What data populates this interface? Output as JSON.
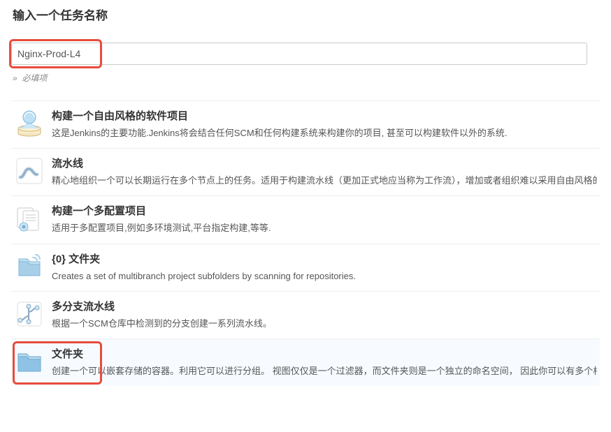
{
  "header": {
    "title": "输入一个任务名称"
  },
  "nameField": {
    "value": "Nginx-Prod-L4"
  },
  "requiredHint": "»  必填项",
  "items": [
    {
      "title": "构建一个自由风格的软件项目",
      "desc": "这是Jenkins的主要功能.Jenkins将会结合任何SCM和任何构建系统来构建你的项目, 甚至可以构建软件以外的系统."
    },
    {
      "title": "流水线",
      "desc": "精心地组织一个可以长期运行在多个节点上的任务。适用于构建流水线（更加正式地应当称为工作流），增加或者组织难以采用自由风格的任务类型。"
    },
    {
      "title": "构建一个多配置项目",
      "desc": "适用于多配置项目,例如多环境测试,平台指定构建,等等."
    },
    {
      "title": "{0} 文件夹",
      "desc": "Creates a set of multibranch project subfolders by scanning for repositories."
    },
    {
      "title": "多分支流水线",
      "desc": "根据一个SCM仓库中检测到的分支创建一系列流水线。"
    },
    {
      "title": "文件夹",
      "desc": "创建一个可以嵌套存储的容器。利用它可以进行分组。 视图仅仅是一个过滤器，而文件夹则是一个独立的命名空间， 因此你可以有多个相同名称的的内容，只要它们在不同的文件夹里即可。"
    }
  ],
  "colors": {
    "highlight": "#e74c3c",
    "border": "#cccccc",
    "text": "#333333",
    "subtext": "#555555"
  }
}
